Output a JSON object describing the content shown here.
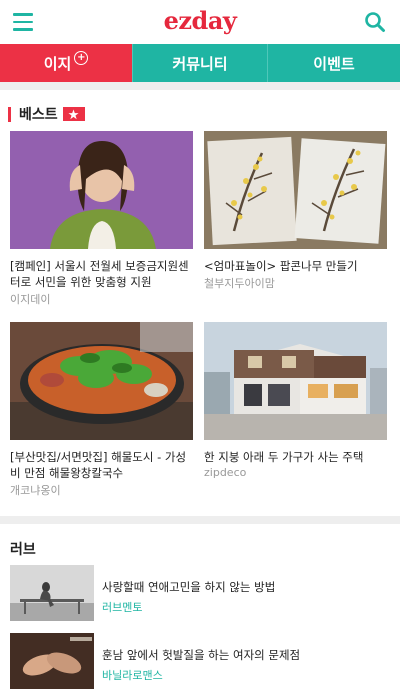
{
  "header": {
    "logo": "ezday",
    "menu_icon": "hamburger-menu-icon",
    "search_icon": "search-icon",
    "logo_color": "#e5283d",
    "accent_color": "#1fb5a3"
  },
  "tabs": [
    {
      "label": "이지",
      "active": true,
      "badge_icon": "plus-circle-icon"
    },
    {
      "label": "커뮤니티",
      "active": false
    },
    {
      "label": "이벤트",
      "active": false
    }
  ],
  "best": {
    "title": "베스트",
    "badge_icon": "star-icon",
    "cards": [
      {
        "title": "[캠페인] 서울시 전월세 보증금지원센터로 서민을 위한 맞춤형 지원",
        "source": "이지데이"
      },
      {
        "title": "<엄마표놀이> 팝콘나무 만들기",
        "source": "철부지두아이맘"
      },
      {
        "title": "[부산맛집/서면맛집] 해물도시 - 가성비 만점 해물왕창칼국수",
        "source": "개코냐옹이"
      },
      {
        "title": "한 지붕 아래 두 가구가 사는 주택",
        "source": "zipdeco"
      }
    ]
  },
  "love": {
    "title": "러브",
    "items": [
      {
        "title": "사랑할때 연애고민을 하지 않는 방법",
        "source": "러브멘토"
      },
      {
        "title": "훈남 앞에서 헛발질을 하는 여자의 문제점",
        "source": "바닐라로맨스"
      }
    ]
  }
}
